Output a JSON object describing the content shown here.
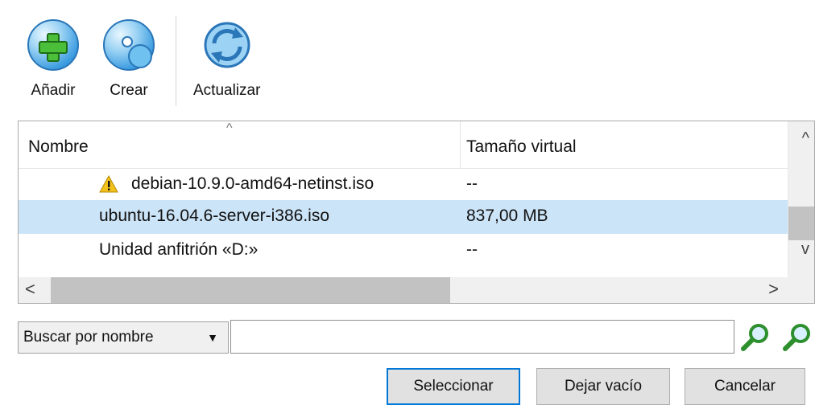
{
  "toolbar": {
    "add_label": "Añadir",
    "create_label": "Crear",
    "refresh_label": "Actualizar"
  },
  "table": {
    "columns": [
      "Nombre",
      "Tamaño virtual"
    ],
    "sort_indicator": "^",
    "rows": [
      {
        "name": "debian-10.9.0-amd64-netinst.iso",
        "size": "--",
        "warning": true
      },
      {
        "name": "ubuntu-16.04.6-server-i386.iso",
        "size": "837,00 MB",
        "selected": true
      },
      {
        "name": "Unidad anfitrión «D:»",
        "size": "--"
      }
    ]
  },
  "scroll": {
    "up": "^",
    "down": "v",
    "left": "<",
    "right": ">"
  },
  "search": {
    "mode": "Buscar por nombre",
    "value": ""
  },
  "buttons": {
    "select": "Seleccionar",
    "clear": "Dejar vacío",
    "cancel": "Cancelar"
  },
  "colors": {
    "selection": "#cce4f7",
    "accent": "#0078d7"
  }
}
